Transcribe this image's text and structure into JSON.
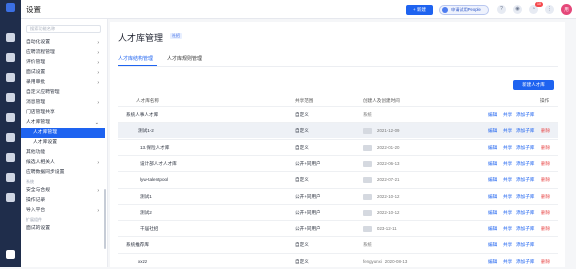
{
  "topbar": {
    "title": "设置",
    "new_label": "+ 新建",
    "trial_label": "申请试用People",
    "notif_count": "10",
    "avatar_text": "用"
  },
  "sidebar": {
    "search_placeholder": "搜索功能名称",
    "items": [
      {
        "label": "自动化设置",
        "chev": "›"
      },
      {
        "label": "应聘流程管理",
        "chev": "›"
      },
      {
        "label": "评价管理",
        "chev": "›"
      },
      {
        "label": "面试设置",
        "chev": "›"
      },
      {
        "label": "录用审批",
        "chev": "›"
      },
      {
        "label": "自定义应聘管理",
        "chev": ""
      },
      {
        "label": "消息管理",
        "chev": "›"
      },
      {
        "label": "门店管理共享",
        "chev": ""
      },
      {
        "label": "人才库管理",
        "chev": "⌄"
      },
      {
        "label": "人才库管理",
        "chev": ""
      },
      {
        "label": "人才库设置",
        "chev": ""
      },
      {
        "label": "其他功能",
        "chev": ""
      },
      {
        "label": "候选人相关人",
        "chev": "›"
      },
      {
        "label": "应聘数据同步设置",
        "chev": ""
      },
      {
        "label": "系统",
        "chev": ""
      },
      {
        "label": "安全与合规",
        "chev": "›"
      },
      {
        "label": "操作记录",
        "chev": ""
      },
      {
        "label": "导入平台",
        "chev": "›"
      },
      {
        "label": "扩展组件",
        "chev": ""
      },
      {
        "label": "面试的设置",
        "chev": ""
      }
    ]
  },
  "page": {
    "title": "人才库管理",
    "badge": "社招",
    "tab_active": "人才库结构管理",
    "tab_other": "人才库规则管理",
    "create_label": "新建人才库"
  },
  "table": {
    "headers": [
      "人才库名称",
      "共享范围",
      "创建人及创建时间",
      "操作"
    ],
    "rows": [
      {
        "name": "系统人事人才库",
        "scope": "自定义",
        "creator": "系统",
        "time": "",
        "acts": [
          "编辑",
          "共享",
          "添加子库",
          ""
        ]
      },
      {
        "name": "测试1-2",
        "scope": "自定义",
        "creator": "",
        "time": "2021-12-09",
        "acts": [
          "编辑",
          "共享",
          "添加子库",
          "删除"
        ]
      },
      {
        "name": "13.保险人才库",
        "scope": "自定义",
        "creator": "",
        "time": "2022-01-20",
        "acts": [
          "编辑",
          "共享",
          "添加子库",
          "删除"
        ]
      },
      {
        "name": "设计部人才人才库",
        "scope": "公开+同用户",
        "creator": "",
        "time": "2022-06-13",
        "acts": [
          "编辑",
          "共享",
          "添加子库",
          "删除"
        ]
      },
      {
        "name": "lyw-talentpool",
        "scope": "自定义",
        "creator": "",
        "time": "2022-07-21",
        "acts": [
          "编辑",
          "共享",
          "添加子库",
          "删除"
        ]
      },
      {
        "name": "测试1",
        "scope": "公开+同用户",
        "creator": "",
        "time": "2022-10-12",
        "acts": [
          "编辑",
          "共享",
          "添加子库",
          "删除"
        ]
      },
      {
        "name": "测试2",
        "scope": "公开+同用户",
        "creator": "",
        "time": "2022-10-12",
        "acts": [
          "编辑",
          "共享",
          "添加子库",
          "删除"
        ]
      },
      {
        "name": "干届社招",
        "scope": "公开+同用户",
        "creator": "",
        "time": "023-12-11",
        "acts": [
          "编辑",
          "共享",
          "添加子库",
          "删除"
        ]
      },
      {
        "name": "系统推荐库",
        "scope": "自定义",
        "creator": "系统",
        "time": "",
        "acts": [
          "编辑",
          "共享",
          "添加子库",
          ""
        ]
      },
      {
        "name": "xxzz",
        "scope": "自定义",
        "creator": "fengyunxi",
        "time": "2020-08-13",
        "acts": [
          "编辑",
          "共享",
          "添加子库",
          "删除"
        ]
      }
    ]
  }
}
